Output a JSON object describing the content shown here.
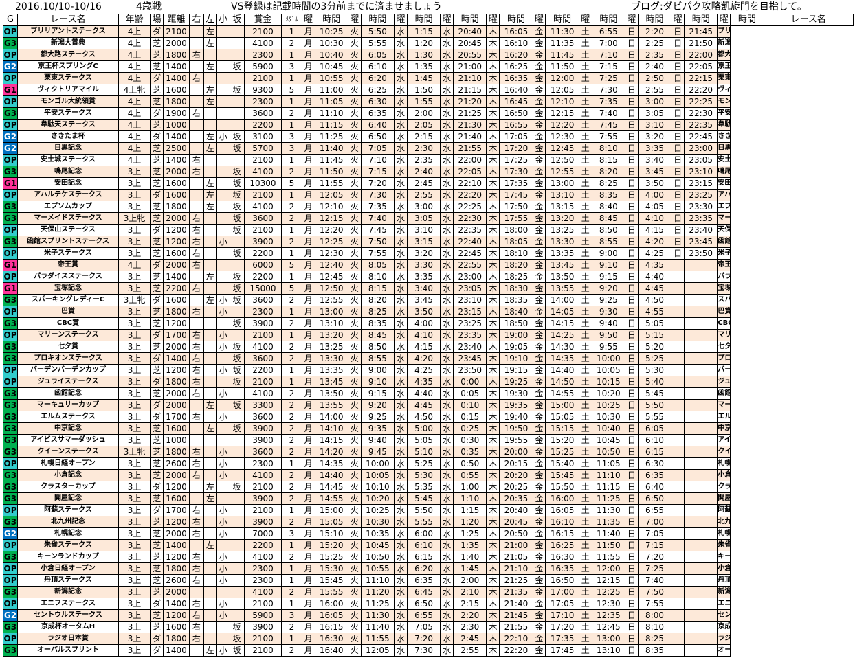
{
  "header": {
    "date_range": "2016.10/10-10/16",
    "age_class": "4歳戦",
    "notice": "VS登録は記載時間の3分前までに済ませましょう",
    "blog": "ブログ:ダビパク攻略凱旋門を目指して。"
  },
  "columns": {
    "grade": "G",
    "name": "レース名",
    "age": "年齢",
    "field": "場",
    "dist": "距離",
    "right": "右",
    "left": "左",
    "small": "小",
    "slope": "坂",
    "prize": "賞金",
    "medal": "ﾒﾀﾞﾙ",
    "day": "曜",
    "time": "時間",
    "name2": "レース名"
  },
  "colors": {
    "OP": "#33cccc",
    "G3": "#00b050",
    "G2": "#0070c0",
    "G1": "#ff3399",
    "stripe": "#fde9d9"
  },
  "days": [
    "月",
    "火",
    "水",
    "水",
    "木",
    "金",
    "土",
    "日",
    "日"
  ],
  "rows": [
    [
      "OP",
      "ブリリアントステークス",
      "4上",
      "ダ",
      "2100",
      "",
      "左",
      "",
      "",
      "2100",
      "1",
      [
        "10:25",
        "5:50",
        "1:15",
        "20:40",
        "16:05",
        "11:30",
        "6:55",
        "2:20",
        "21:45"
      ]
    ],
    [
      "G3",
      "新潟大賞典",
      "4上",
      "芝",
      "2000",
      "",
      "左",
      "",
      "",
      "4100",
      "2",
      [
        "10:30",
        "5:55",
        "1:20",
        "20:45",
        "16:10",
        "11:35",
        "7:00",
        "2:25",
        "21:50"
      ]
    ],
    [
      "OP",
      "都大路ステークス",
      "4上",
      "芝",
      "1800",
      "右",
      "",
      "",
      "",
      "2300",
      "1",
      [
        "10:40",
        "6:05",
        "1:30",
        "20:55",
        "16:20",
        "11:45",
        "7:10",
        "2:35",
        "22:00"
      ]
    ],
    [
      "G2",
      "京王杯スプリングC",
      "4上",
      "芝",
      "1400",
      "",
      "左",
      "",
      "坂",
      "5900",
      "3",
      [
        "10:45",
        "6:10",
        "1:35",
        "21:00",
        "16:25",
        "11:50",
        "7:15",
        "2:40",
        "22:05"
      ]
    ],
    [
      "OP",
      "栗東ステークス",
      "4上",
      "ダ",
      "1400",
      "右",
      "",
      "",
      "",
      "2100",
      "1",
      [
        "10:55",
        "6:20",
        "1:45",
        "21:10",
        "16:35",
        "12:00",
        "7:25",
        "2:50",
        "22:15"
      ]
    ],
    [
      "G1",
      "ヴィクトリアマイル",
      "4上牝",
      "芝",
      "1600",
      "",
      "左",
      "",
      "坂",
      "9300",
      "5",
      [
        "11:00",
        "6:25",
        "1:50",
        "21:15",
        "16:40",
        "12:05",
        "7:30",
        "2:55",
        "22:20"
      ]
    ],
    [
      "OP",
      "モンゴル大統領賞",
      "4上",
      "芝",
      "1800",
      "",
      "左",
      "",
      "",
      "2300",
      "1",
      [
        "11:05",
        "6:30",
        "1:55",
        "21:20",
        "16:45",
        "12:10",
        "7:35",
        "3:00",
        "22:25"
      ]
    ],
    [
      "G3",
      "平安ステークス",
      "4上",
      "ダ",
      "1900",
      "右",
      "",
      "",
      "",
      "3600",
      "2",
      [
        "11:10",
        "6:35",
        "2:00",
        "21:25",
        "16:50",
        "12:15",
        "7:40",
        "3:05",
        "22:30"
      ]
    ],
    [
      "OP",
      "韋駄天ステークス",
      "4上",
      "芝",
      "1000",
      "",
      "",
      "",
      "",
      "2200",
      "1",
      [
        "11:15",
        "6:40",
        "2:05",
        "21:30",
        "16:55",
        "12:20",
        "7:45",
        "3:10",
        "22:35"
      ]
    ],
    [
      "G2",
      "さきたま杯",
      "4上",
      "ダ",
      "1400",
      "",
      "左",
      "小",
      "坂",
      "3100",
      "3",
      [
        "11:25",
        "6:50",
        "2:15",
        "21:40",
        "17:05",
        "12:30",
        "7:55",
        "3:20",
        "22:45"
      ]
    ],
    [
      "G2",
      "目黒記念",
      "4上",
      "芝",
      "2500",
      "",
      "左",
      "",
      "坂",
      "5700",
      "3",
      [
        "11:40",
        "7:05",
        "2:30",
        "21:55",
        "17:20",
        "12:45",
        "8:10",
        "3:35",
        "23:00"
      ]
    ],
    [
      "OP",
      "安土城ステークス",
      "4上",
      "芝",
      "1400",
      "右",
      "",
      "",
      "",
      "2100",
      "1",
      [
        "11:45",
        "7:10",
        "2:35",
        "22:00",
        "17:25",
        "12:50",
        "8:15",
        "3:40",
        "23:05"
      ]
    ],
    [
      "G3",
      "鳴尾記念",
      "3上",
      "芝",
      "2000",
      "右",
      "",
      "",
      "坂",
      "4100",
      "2",
      [
        "11:50",
        "7:15",
        "2:40",
        "22:05",
        "17:30",
        "12:55",
        "8:20",
        "3:45",
        "23:10"
      ]
    ],
    [
      "G1",
      "安田記念",
      "3上",
      "芝",
      "1600",
      "",
      "左",
      "",
      "坂",
      "10300",
      "5",
      [
        "11:55",
        "7:20",
        "2:45",
        "22:10",
        "17:35",
        "13:00",
        "8:25",
        "3:50",
        "23:15"
      ]
    ],
    [
      "OP",
      "アハルテケステークス",
      "3上",
      "ダ",
      "1600",
      "",
      "左",
      "",
      "坂",
      "2100",
      "1",
      [
        "12:05",
        "7:30",
        "2:55",
        "22:20",
        "17:45",
        "13:10",
        "8:35",
        "4:00",
        "23:25"
      ]
    ],
    [
      "G3",
      "エプソムカップ",
      "3上",
      "芝",
      "1800",
      "",
      "左",
      "",
      "坂",
      "4100",
      "2",
      [
        "12:10",
        "7:35",
        "3:00",
        "22:25",
        "17:50",
        "13:15",
        "8:40",
        "4:05",
        "23:30"
      ]
    ],
    [
      "G3",
      "マーメイドステークス",
      "3上牝",
      "芝",
      "2000",
      "右",
      "",
      "",
      "坂",
      "3600",
      "2",
      [
        "12:15",
        "7:40",
        "3:05",
        "22:30",
        "17:55",
        "13:20",
        "8:45",
        "4:10",
        "23:35"
      ]
    ],
    [
      "OP",
      "天保山ステークス",
      "3上",
      "ダ",
      "1200",
      "右",
      "",
      "",
      "坂",
      "2100",
      "1",
      [
        "12:20",
        "7:45",
        "3:10",
        "22:35",
        "18:00",
        "13:25",
        "8:50",
        "4:15",
        "23:40"
      ]
    ],
    [
      "G3",
      "函館スプリントステークス",
      "3上",
      "芝",
      "1200",
      "右",
      "",
      "小",
      "",
      "3900",
      "2",
      [
        "12:25",
        "7:50",
        "3:15",
        "22:40",
        "18:05",
        "13:30",
        "8:55",
        "4:20",
        "23:45"
      ]
    ],
    [
      "OP",
      "米子ステークス",
      "3上",
      "芝",
      "1600",
      "右",
      "",
      "",
      "坂",
      "2200",
      "1",
      [
        "12:30",
        "7:55",
        "3:20",
        "22:45",
        "18:10",
        "13:35",
        "9:00",
        "4:25",
        "23:50"
      ]
    ],
    [
      "G1",
      "帝王賞",
      "4上",
      "ダ",
      "2000",
      "右",
      "",
      "",
      "",
      "6000",
      "5",
      [
        "12:40",
        "8:05",
        "3:30",
        "22:55",
        "18:20",
        "13:45",
        "9:10",
        "4:35",
        ""
      ]
    ],
    [
      "OP",
      "パラダイスステークス",
      "3上",
      "芝",
      "1400",
      "",
      "左",
      "",
      "坂",
      "2200",
      "1",
      [
        "12:45",
        "8:10",
        "3:35",
        "23:00",
        "18:25",
        "13:50",
        "9:15",
        "4:40",
        ""
      ]
    ],
    [
      "G1",
      "宝塚記念",
      "3上",
      "芝",
      "2200",
      "右",
      "",
      "",
      "坂",
      "15000",
      "5",
      [
        "12:50",
        "8:15",
        "3:40",
        "23:05",
        "18:30",
        "13:55",
        "9:20",
        "4:45",
        ""
      ]
    ],
    [
      "G3",
      "スパーキングレディーC",
      "3上牝",
      "ダ",
      "1600",
      "",
      "左",
      "小",
      "坂",
      "3600",
      "2",
      [
        "12:55",
        "8:20",
        "3:45",
        "23:10",
        "18:35",
        "14:00",
        "9:25",
        "4:50",
        ""
      ]
    ],
    [
      "OP",
      "巴賞",
      "3上",
      "芝",
      "1800",
      "右",
      "",
      "小",
      "",
      "2300",
      "1",
      [
        "13:00",
        "8:25",
        "3:50",
        "23:15",
        "18:40",
        "14:05",
        "9:30",
        "4:55",
        ""
      ]
    ],
    [
      "G3",
      "CBC賞",
      "3上",
      "芝",
      "1200",
      "",
      "",
      "",
      "坂",
      "3900",
      "2",
      [
        "13:10",
        "8:35",
        "4:00",
        "23:25",
        "18:50",
        "14:15",
        "9:40",
        "5:05",
        ""
      ]
    ],
    [
      "OP",
      "マリーンステークス",
      "3上",
      "ダ",
      "1700",
      "右",
      "",
      "小",
      "",
      "2100",
      "1",
      [
        "13:20",
        "8:45",
        "4:10",
        "23:35",
        "19:00",
        "14:25",
        "9:50",
        "5:15",
        ""
      ]
    ],
    [
      "G3",
      "七夕賞",
      "3上",
      "芝",
      "2000",
      "右",
      "",
      "小",
      "坂",
      "4100",
      "2",
      [
        "13:25",
        "8:50",
        "4:15",
        "23:40",
        "19:05",
        "14:30",
        "9:55",
        "5:20",
        ""
      ]
    ],
    [
      "G3",
      "プロキオンステークス",
      "3上",
      "ダ",
      "1400",
      "右",
      "",
      "",
      "坂",
      "3600",
      "2",
      [
        "13:30",
        "8:55",
        "4:20",
        "23:45",
        "19:10",
        "14:35",
        "10:00",
        "5:25",
        ""
      ]
    ],
    [
      "OP",
      "バーデンバーデンカップ",
      "3上",
      "芝",
      "1200",
      "右",
      "",
      "小",
      "坂",
      "2200",
      "1",
      [
        "13:35",
        "9:00",
        "4:25",
        "23:50",
        "19:15",
        "14:40",
        "10:05",
        "5:30",
        ""
      ]
    ],
    [
      "OP",
      "ジュライステークス",
      "3上",
      "ダ",
      "1800",
      "右",
      "",
      "",
      "坂",
      "2100",
      "1",
      [
        "13:45",
        "9:10",
        "4:35",
        "0:00",
        "19:25",
        "14:50",
        "10:15",
        "5:40",
        ""
      ]
    ],
    [
      "G3",
      "函館記念",
      "3上",
      "芝",
      "2000",
      "右",
      "",
      "小",
      "",
      "4100",
      "2",
      [
        "13:50",
        "9:15",
        "4:40",
        "0:05",
        "19:30",
        "14:55",
        "10:20",
        "5:45",
        ""
      ]
    ],
    [
      "G3",
      "マーキュリーカップ",
      "3上",
      "ダ",
      "2000",
      "",
      "左",
      "",
      "坂",
      "3300",
      "2",
      [
        "13:55",
        "9:20",
        "4:45",
        "0:10",
        "19:35",
        "15:00",
        "10:25",
        "5:50",
        ""
      ]
    ],
    [
      "G3",
      "エルムステークス",
      "3上",
      "ダ",
      "1700",
      "右",
      "",
      "小",
      "",
      "3600",
      "2",
      [
        "14:00",
        "9:25",
        "4:50",
        "0:15",
        "19:40",
        "15:05",
        "10:30",
        "5:55",
        ""
      ]
    ],
    [
      "G3",
      "中京記念",
      "3上",
      "芝",
      "1600",
      "",
      "左",
      "",
      "坂",
      "3900",
      "2",
      [
        "14:10",
        "9:35",
        "5:00",
        "0:25",
        "19:50",
        "15:15",
        "10:40",
        "6:05",
        ""
      ]
    ],
    [
      "G3",
      "アイビスサマーダッシュ",
      "3上",
      "芝",
      "1000",
      "",
      "",
      "",
      "",
      "3900",
      "2",
      [
        "14:15",
        "9:40",
        "5:05",
        "0:30",
        "19:55",
        "15:20",
        "10:45",
        "6:10",
        ""
      ]
    ],
    [
      "G3",
      "クイーンステークス",
      "3上牝",
      "芝",
      "1800",
      "右",
      "",
      "小",
      "",
      "3600",
      "2",
      [
        "14:20",
        "9:45",
        "5:10",
        "0:35",
        "20:00",
        "15:25",
        "10:50",
        "6:15",
        ""
      ]
    ],
    [
      "OP",
      "札幌日経オープン",
      "3上",
      "芝",
      "2600",
      "右",
      "",
      "小",
      "",
      "2300",
      "1",
      [
        "14:35",
        "10:00",
        "5:25",
        "0:50",
        "20:15",
        "15:40",
        "11:05",
        "6:30",
        ""
      ]
    ],
    [
      "G3",
      "小倉記念",
      "3上",
      "芝",
      "2000",
      "右",
      "",
      "小",
      "",
      "4100",
      "2",
      [
        "14:40",
        "10:05",
        "5:30",
        "0:55",
        "20:20",
        "15:45",
        "11:10",
        "6:35",
        ""
      ]
    ],
    [
      "G3",
      "クラスターカップ",
      "3上",
      "ダ",
      "1200",
      "",
      "左",
      "",
      "坂",
      "2100",
      "2",
      [
        "14:45",
        "10:10",
        "5:35",
        "1:00",
        "20:25",
        "15:50",
        "11:15",
        "6:40",
        ""
      ]
    ],
    [
      "G3",
      "関屋記念",
      "3上",
      "芝",
      "1600",
      "",
      "左",
      "",
      "",
      "3900",
      "2",
      [
        "14:55",
        "10:20",
        "5:45",
        "1:10",
        "20:35",
        "16:00",
        "11:25",
        "6:50",
        ""
      ]
    ],
    [
      "OP",
      "阿蘇ステークス",
      "3上",
      "ダ",
      "1700",
      "右",
      "",
      "小",
      "",
      "2100",
      "1",
      [
        "15:00",
        "10:25",
        "5:50",
        "1:15",
        "20:40",
        "16:05",
        "11:30",
        "6:55",
        ""
      ]
    ],
    [
      "G3",
      "北九州記念",
      "3上",
      "芝",
      "1200",
      "右",
      "",
      "小",
      "",
      "3900",
      "2",
      [
        "15:05",
        "10:30",
        "5:55",
        "1:20",
        "20:45",
        "16:10",
        "11:35",
        "7:00",
        ""
      ]
    ],
    [
      "G2",
      "札幌記念",
      "3上",
      "芝",
      "2000",
      "右",
      "",
      "小",
      "",
      "7000",
      "3",
      [
        "15:10",
        "10:35",
        "6:00",
        "1:25",
        "20:50",
        "16:15",
        "11:40",
        "7:05",
        ""
      ]
    ],
    [
      "OP",
      "朱雀ステークス",
      "3上",
      "芝",
      "1400",
      "",
      "左",
      "",
      "",
      "2200",
      "1",
      [
        "15:20",
        "10:45",
        "6:10",
        "1:35",
        "21:00",
        "16:25",
        "11:50",
        "7:15",
        ""
      ]
    ],
    [
      "G3",
      "キーンランドカップ",
      "3上",
      "芝",
      "1200",
      "右",
      "",
      "小",
      "",
      "4100",
      "2",
      [
        "15:25",
        "10:50",
        "6:15",
        "1:40",
        "21:05",
        "16:30",
        "11:55",
        "7:20",
        ""
      ]
    ],
    [
      "OP",
      "小倉日経オープン",
      "3上",
      "芝",
      "1800",
      "右",
      "",
      "小",
      "",
      "2300",
      "1",
      [
        "15:30",
        "10:55",
        "6:20",
        "1:45",
        "21:10",
        "16:35",
        "12:00",
        "7:25",
        ""
      ]
    ],
    [
      "OP",
      "丹頂ステークス",
      "3上",
      "芝",
      "2600",
      "右",
      "",
      "小",
      "",
      "2300",
      "1",
      [
        "15:45",
        "11:10",
        "6:35",
        "2:00",
        "21:25",
        "16:50",
        "12:15",
        "7:40",
        ""
      ]
    ],
    [
      "G3",
      "新潟記念",
      "3上",
      "芝",
      "2000",
      "",
      "",
      "",
      "",
      "4100",
      "2",
      [
        "15:55",
        "11:20",
        "6:45",
        "2:10",
        "21:35",
        "17:00",
        "12:25",
        "7:50",
        ""
      ]
    ],
    [
      "OP",
      "エニフステークス",
      "3上",
      "ダ",
      "1400",
      "右",
      "",
      "小",
      "",
      "2100",
      "1",
      [
        "16:00",
        "11:25",
        "6:50",
        "2:15",
        "21:40",
        "17:05",
        "12:30",
        "7:55",
        ""
      ]
    ],
    [
      "G2",
      "セントウルステークス",
      "3上",
      "芝",
      "1200",
      "右",
      "",
      "小",
      "",
      "5900",
      "3",
      [
        "16:05",
        "11:30",
        "6:55",
        "2:20",
        "21:45",
        "17:10",
        "12:35",
        "8:00",
        ""
      ]
    ],
    [
      "G3",
      "京成杯オータムH",
      "3上",
      "芝",
      "1600",
      "右",
      "",
      "",
      "坂",
      "3900",
      "2",
      [
        "16:15",
        "11:40",
        "7:05",
        "2:30",
        "21:55",
        "17:20",
        "12:45",
        "8:10",
        ""
      ]
    ],
    [
      "OP",
      "ラジオ日本賞",
      "3上",
      "ダ",
      "1800",
      "右",
      "",
      "",
      "坂",
      "2100",
      "1",
      [
        "16:30",
        "11:55",
        "7:20",
        "2:45",
        "22:10",
        "17:35",
        "13:00",
        "8:25",
        ""
      ]
    ],
    [
      "G3",
      "オーバルスプリント",
      "3上",
      "ダ",
      "1400",
      "",
      "左",
      "小",
      "坂",
      "2100",
      "2",
      [
        "16:40",
        "12:05",
        "7:30",
        "2:55",
        "22:20",
        "17:45",
        "13:10",
        "8:35",
        ""
      ]
    ]
  ]
}
